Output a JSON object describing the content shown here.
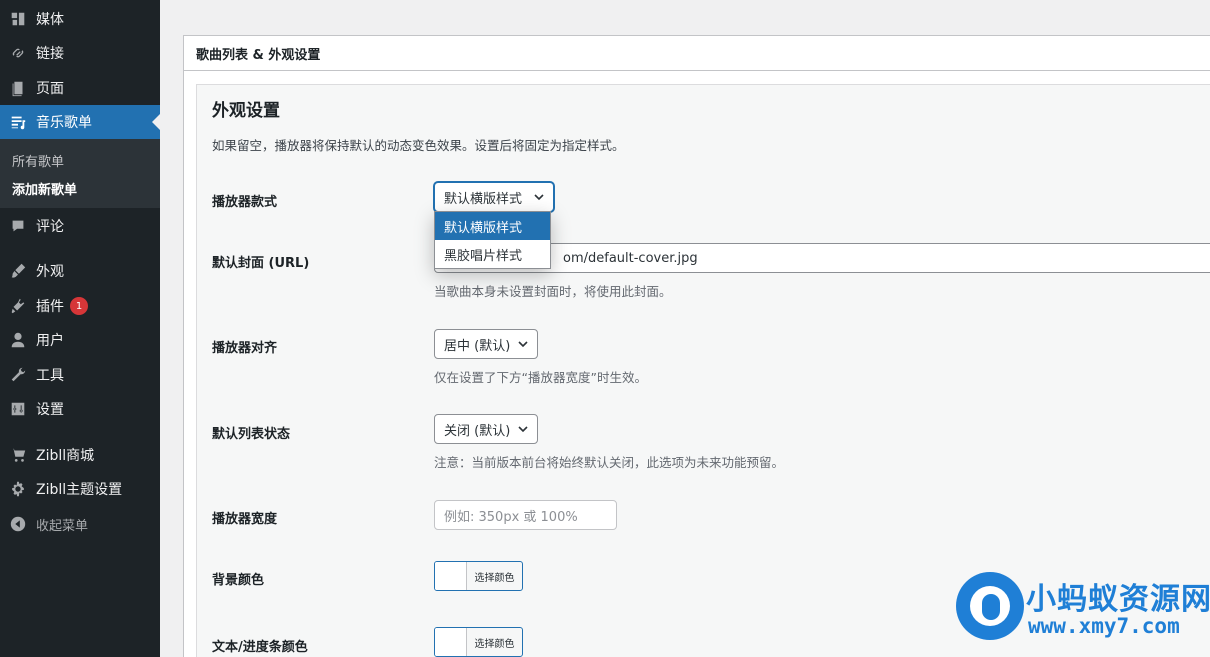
{
  "sidebar": {
    "items": [
      {
        "label": "媒体",
        "icon": "media-icon"
      },
      {
        "label": "链接",
        "icon": "link-icon"
      },
      {
        "label": "页面",
        "icon": "page-icon"
      },
      {
        "label": "音乐歌单",
        "icon": "playlist-icon"
      },
      {
        "label": "评论",
        "icon": "comment-icon"
      },
      {
        "label": "外观",
        "icon": "brush-icon"
      },
      {
        "label": "插件",
        "icon": "plugin-icon"
      },
      {
        "label": "用户",
        "icon": "user-icon"
      },
      {
        "label": "工具",
        "icon": "wrench-icon"
      },
      {
        "label": "设置",
        "icon": "settings-icon"
      },
      {
        "label": "Zibll商城",
        "icon": "cart-icon"
      },
      {
        "label": "Zibll主题设置",
        "icon": "gear-icon"
      },
      {
        "label": "收起菜单",
        "icon": "collapse-icon"
      }
    ],
    "submenu": [
      "所有歌单",
      "添加新歌单"
    ],
    "plugin_badge": "1"
  },
  "panel": {
    "header": "歌曲列表 & 外观设置",
    "section_title": "外观设置",
    "section_desc": "如果留空，播放器将保持默认的动态变色效果。设置后将固定为指定样式。",
    "fields": {
      "style": {
        "label": "播放器款式",
        "value": "默认横版样式",
        "options": [
          "默认横版样式",
          "黑胶唱片样式"
        ]
      },
      "cover": {
        "label": "默认封面 (URL)",
        "value": "om/default-cover.jpg",
        "help": "当歌曲本身未设置封面时，将使用此封面。"
      },
      "align": {
        "label": "播放器对齐",
        "value": "居中 (默认)",
        "help": "仅在设置了下方“播放器宽度”时生效。"
      },
      "list_state": {
        "label": "默认列表状态",
        "value": "关闭 (默认)",
        "help": "注意：当前版本前台将始终默认关闭，此选项为未来功能预留。"
      },
      "width": {
        "label": "播放器宽度",
        "placeholder": "例如: 350px 或 100%"
      },
      "bg_color": {
        "label": "背景颜色",
        "button": "选择颜色"
      },
      "text_color": {
        "label": "文本/进度条颜色",
        "button": "选择颜色"
      }
    }
  },
  "watermark": {
    "brand": "小蚂蚁资源网",
    "url": "www.xmy7.com"
  },
  "colors": {
    "sidebar": "#1d2327",
    "accent": "#2271b1",
    "badge": "#d63638",
    "watermark": "#1f7fd6"
  }
}
